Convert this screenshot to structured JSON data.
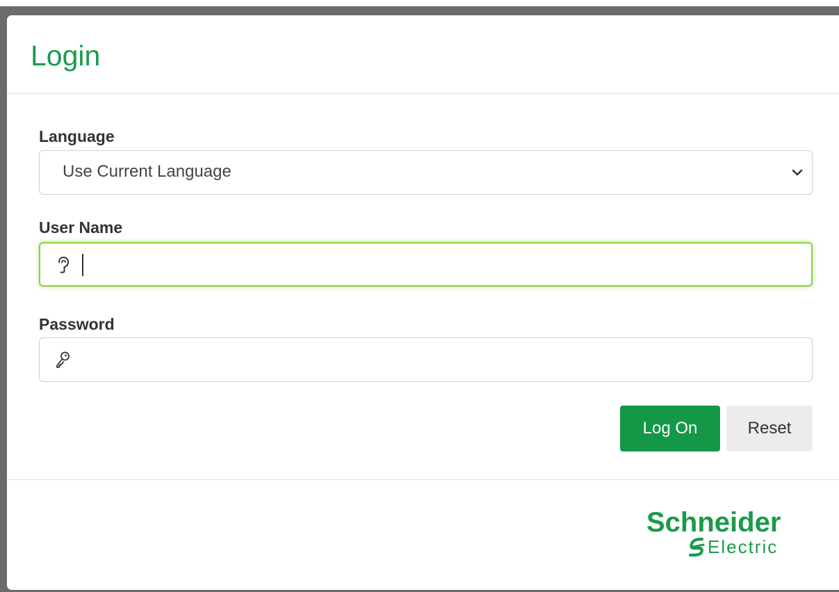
{
  "dialog": {
    "title": "Login",
    "accent_color": "#1b9a4b"
  },
  "form": {
    "language": {
      "label": "Language",
      "selected": "Use Current Language",
      "icon": "chevron-down-icon"
    },
    "username": {
      "label": "User Name",
      "value": "",
      "icon": "user-icon",
      "focused": true
    },
    "password": {
      "label": "Password",
      "value": "",
      "icon": "key-icon"
    }
  },
  "buttons": {
    "logon_label": "Log On",
    "reset_label": "Reset"
  },
  "footer": {
    "logo_line1": "Schneider",
    "logo_line2": "Electric"
  }
}
